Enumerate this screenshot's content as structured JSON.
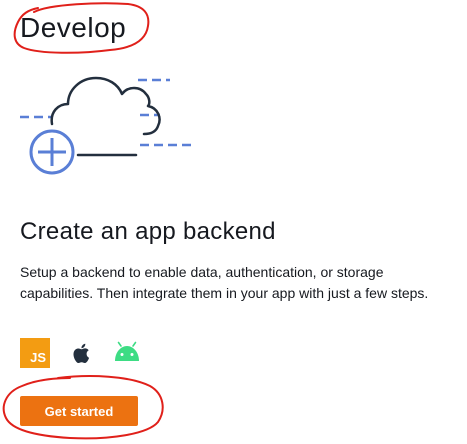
{
  "section": {
    "title": "Develop"
  },
  "card": {
    "title": "Create an app backend",
    "description": "Setup a backend to enable data, authentication, or storage capabilities. Then integrate them in your app with just a few steps.",
    "platforms": [
      {
        "name": "JavaScript",
        "icon": "js-icon",
        "label": "JS",
        "color": "#f39c12"
      },
      {
        "name": "Apple",
        "icon": "apple-icon",
        "color": "#232f3e"
      },
      {
        "name": "Android",
        "icon": "android-icon",
        "color": "#3ddc84"
      }
    ],
    "cta_label": "Get started"
  },
  "colors": {
    "accent": "#ec7211",
    "illustration_blue": "#5a7fd6",
    "illustration_line": "#232f3e",
    "annotation_red": "#e0201a"
  }
}
